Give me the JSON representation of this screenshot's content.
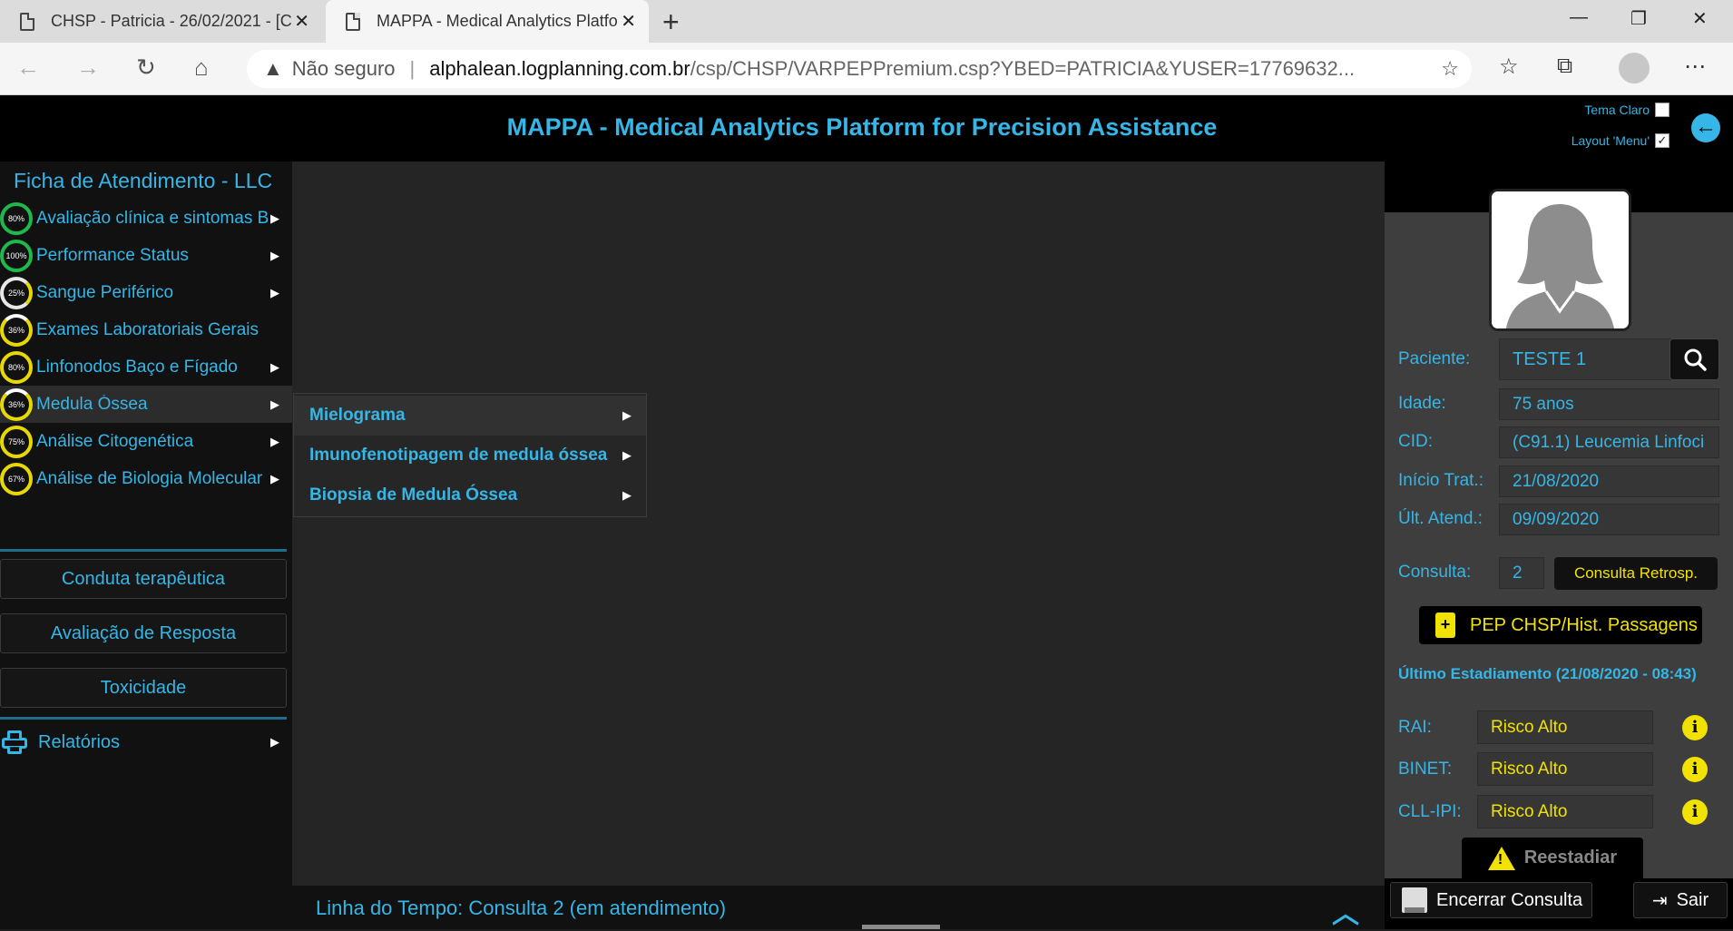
{
  "browser": {
    "tabs": [
      {
        "title": "CHSP - Patricia - 26/02/2021 - [C"
      },
      {
        "title": "MAPPA - Medical Analytics Platfo"
      }
    ],
    "address": {
      "security_label": "Não seguro",
      "host": "alphalean.logplanning.com.br",
      "path": "/csp/CHSP/VARPEPPremium.csp?YBED=PATRICIA&YUSER=17769632..."
    }
  },
  "header": {
    "title": "MAPPA - Medical Analytics Platform for Precision Assistance",
    "light_theme_label": "Tema Claro",
    "layout_menu_label": "Layout 'Menu'",
    "light_theme_checked": false,
    "layout_menu_checked": true
  },
  "sidebar": {
    "title": "Ficha de Atendimento - LLC",
    "items": [
      {
        "percent": "80%",
        "label": "Avaliação clínica e sintomas B",
        "gauge": "green",
        "has_caret": true
      },
      {
        "percent": "100%",
        "label": "Performance Status",
        "gauge": "green",
        "has_caret": true
      },
      {
        "percent": "25%",
        "label": "Sangue Periférico",
        "gauge": "white",
        "has_caret": true
      },
      {
        "percent": "36%",
        "label": "Exames Laboratoriais Gerais",
        "gauge": "yellow",
        "has_caret": false
      },
      {
        "percent": "80%",
        "label": "Linfonodos Baço e Fígado",
        "gauge": "yellow",
        "has_caret": true
      },
      {
        "percent": "36%",
        "label": "Medula Óssea",
        "gauge": "yellow",
        "has_caret": true,
        "active": true
      },
      {
        "percent": "75%",
        "label": "Análise Citogenética",
        "gauge": "yellow",
        "has_caret": true
      },
      {
        "percent": "67%",
        "label": "Análise de Biologia Molecular",
        "gauge": "yellow",
        "has_caret": true
      }
    ],
    "buttons": {
      "therapy": "Conduta terapêutica",
      "response": "Avaliação de Resposta",
      "toxicity": "Toxicidade"
    },
    "reports_label": "Relatórios"
  },
  "submenu": {
    "items": [
      {
        "label": "Mielograma"
      },
      {
        "label": "Imunofenotipagem de medula óssea"
      },
      {
        "label": "Biopsia de Medula Óssea"
      }
    ]
  },
  "timeline": {
    "label": "Linha do Tempo: Consulta 2 (em atendimento)"
  },
  "patient": {
    "name_label": "Paciente:",
    "name": "TESTE 1",
    "age_label": "Idade:",
    "age": "75 anos",
    "cid_label": "CID:",
    "cid": "(C91.1) Leucemia Linfoci",
    "start_label": "Início Trat.:",
    "start": "21/08/2020",
    "last_label": "Últ. Atend.:",
    "last": "09/09/2020",
    "consult_label": "Consulta:",
    "consult": "2",
    "retro_button": "Consulta Retrosp.",
    "pep_button": "PEP CHSP/Hist. Passagens"
  },
  "staging": {
    "title": "Último Estadiamento (21/08/2020 - 08:43)",
    "rows": [
      {
        "label": "RAI:",
        "value": "Risco Alto"
      },
      {
        "label": "BINET:",
        "value": "Risco Alto"
      },
      {
        "label": "CLL-IPI:",
        "value": "Risco Alto"
      }
    ],
    "restage_button": "Reestadiar"
  },
  "footer": {
    "end_button": "Encerrar Consulta",
    "exit_button": "Sair"
  },
  "colors": {
    "accent": "#35b6e6",
    "warning": "#f2e200",
    "gauge_green": "#1fb84a",
    "gauge_yellow": "#e6d800"
  }
}
